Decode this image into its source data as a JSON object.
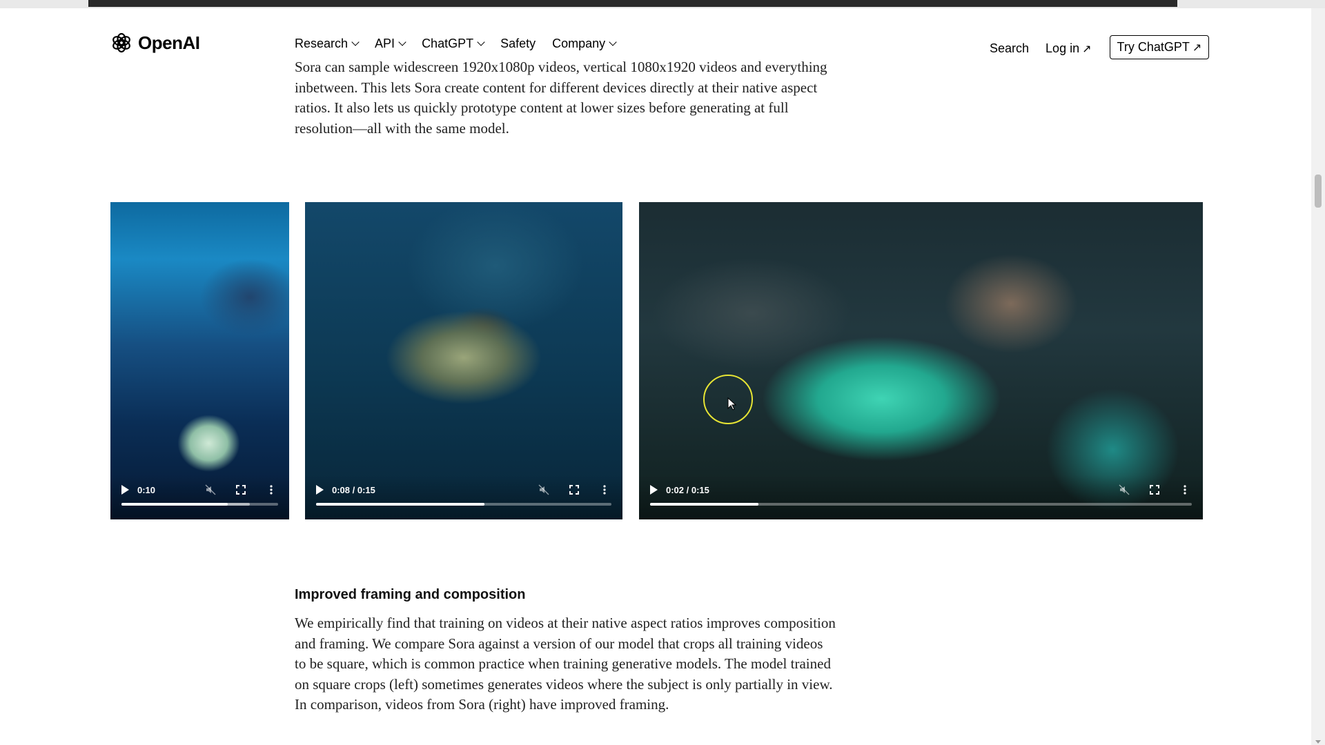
{
  "brand": {
    "name": "OpenAI",
    "logo_icon": "openai-logo-icon"
  },
  "nav": {
    "items": [
      {
        "label": "Research",
        "has_dropdown": true
      },
      {
        "label": "API",
        "has_dropdown": true
      },
      {
        "label": "ChatGPT",
        "has_dropdown": true
      },
      {
        "label": "Safety",
        "has_dropdown": false
      },
      {
        "label": "Company",
        "has_dropdown": true
      }
    ],
    "search_label": "Search",
    "login_label": "Log in",
    "cta_label": "Try ChatGPT",
    "external_arrow": "↗"
  },
  "article": {
    "intro_paragraph": "Sora can sample widescreen 1920x1080p videos, vertical 1080x1920 videos and everything inbetween. This lets Sora create content for different devices directly at their native aspect ratios. It also lets us quickly prototype content at lower sizes before generating at full resolution—all with the same model.",
    "section_heading": "Improved framing and composition",
    "section_paragraph": "We empirically find that training on videos at their native aspect ratios improves composition and framing. We compare Sora against a version of our model that crops all training videos to be square, which is common practice when training generative models. The model trained on square crops (left) sometimes generates videos where the subject is only partially in view. In comparison, videos from Sora (right) have improved framing."
  },
  "videos": [
    {
      "time_label": "0:10",
      "progress": 0.68,
      "buffered": 0.82
    },
    {
      "time_label": "0:08 / 0:15",
      "progress": 0.57,
      "buffered": 0.57
    },
    {
      "time_label": "0:02 / 0:15",
      "progress": 0.2,
      "buffered": 0.2
    }
  ],
  "colors": {
    "cursor_highlight": "#e7e534",
    "text": "#222222"
  }
}
